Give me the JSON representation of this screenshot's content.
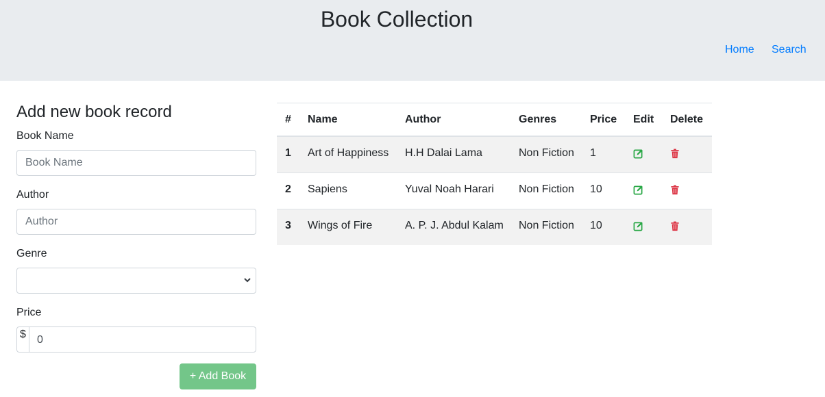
{
  "header": {
    "title": "Book Collection",
    "nav": [
      {
        "label": "Home"
      },
      {
        "label": "Search"
      }
    ]
  },
  "form": {
    "title": "Add new book record",
    "book_name": {
      "label": "Book Name",
      "placeholder": "Book Name",
      "value": ""
    },
    "author": {
      "label": "Author",
      "placeholder": "Author",
      "value": ""
    },
    "genre": {
      "label": "Genre",
      "selected": ""
    },
    "price": {
      "label": "Price",
      "prefix": "$",
      "value": "0"
    },
    "submit_label": "+ Add Book"
  },
  "table": {
    "columns": [
      "#",
      "Name",
      "Author",
      "Genres",
      "Price",
      "Edit",
      "Delete"
    ],
    "rows": [
      {
        "index": "1",
        "name": "Art of Happiness",
        "author": "H.H Dalai Lama",
        "genres": "Non Fiction",
        "price": "1"
      },
      {
        "index": "2",
        "name": "Sapiens",
        "author": "Yuval Noah Harari",
        "genres": "Non Fiction",
        "price": "10"
      },
      {
        "index": "3",
        "name": "Wings of Fire",
        "author": "A. P. J. Abdul Kalam",
        "genres": "Non Fiction",
        "price": "10"
      }
    ],
    "edit_icon": "edit-icon",
    "delete_icon": "trash-icon"
  },
  "colors": {
    "header_bg": "#e9ecef",
    "link": "#007bff",
    "add_button": "#73c689",
    "edit_icon": "#28a745",
    "delete_icon": "#dc3545",
    "row_stripe": "#f2f2f2"
  }
}
